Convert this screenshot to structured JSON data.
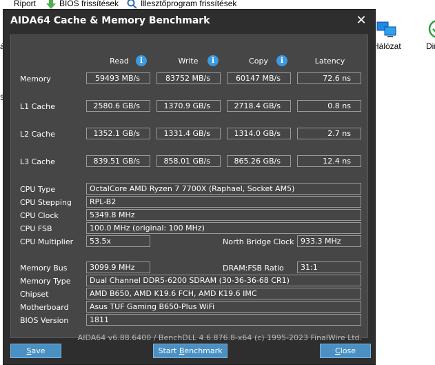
{
  "background": {
    "toolbar": [
      {
        "label": "Riport"
      },
      {
        "label": "BIOS frissítések"
      },
      {
        "label": "Illesztőprogram frissítések"
      }
    ],
    "side_labels": [
      "á",
      "S"
    ],
    "right_items": [
      {
        "label": "Hálózat"
      },
      {
        "label": "Dir"
      }
    ]
  },
  "window": {
    "title": "AIDA64 Cache & Memory Benchmark",
    "close_glyph": "✕"
  },
  "columns": {
    "read": "Read",
    "write": "Write",
    "copy": "Copy",
    "latency": "Latency"
  },
  "bench_rows": [
    {
      "label": "Memory",
      "read": "59493 MB/s",
      "write": "83752 MB/s",
      "copy": "60147 MB/s",
      "latency": "72.6 ns"
    },
    {
      "label": "L1 Cache",
      "read": "2580.6 GB/s",
      "write": "1370.9 GB/s",
      "copy": "2718.4 GB/s",
      "latency": "0.8 ns"
    },
    {
      "label": "L2 Cache",
      "read": "1352.1 GB/s",
      "write": "1331.4 GB/s",
      "copy": "1314.0 GB/s",
      "latency": "2.7 ns"
    },
    {
      "label": "L3 Cache",
      "read": "839.51 GB/s",
      "write": "858.01 GB/s",
      "copy": "865.26 GB/s",
      "latency": "12.4 ns"
    }
  ],
  "cpu": {
    "type_label": "CPU Type",
    "type_value": "OctalCore AMD Ryzen 7 7700X  (Raphael, Socket AM5)",
    "stepping_label": "CPU Stepping",
    "stepping_value": "RPL-B2",
    "clock_label": "CPU Clock",
    "clock_value": "5349.8 MHz",
    "fsb_label": "CPU FSB",
    "fsb_value": "100.0 MHz  (original: 100 MHz)",
    "multiplier_label": "CPU Multiplier",
    "multiplier_value": "53.5x",
    "nb_clock_label": "North Bridge Clock",
    "nb_clock_value": "933.3 MHz"
  },
  "system": {
    "membus_label": "Memory Bus",
    "membus_value": "3099.9 MHz",
    "ratio_label": "DRAM:FSB Ratio",
    "ratio_value": "31:1",
    "memtype_label": "Memory Type",
    "memtype_value": "Dual Channel DDR5-6200 SDRAM  (30-36-36-68 CR1)",
    "chipset_label": "Chipset",
    "chipset_value": "AMD B650, AMD K19.6 FCH, AMD K19.6 IMC",
    "motherboard_label": "Motherboard",
    "motherboard_value": "Asus TUF Gaming B650-Plus WiFi",
    "bios_label": "BIOS Version",
    "bios_value": "1811"
  },
  "footer_text": "AIDA64 v6.88.6400 / BenchDLL 4.6.876.8-x64  (c) 1995-2023 FinalWire Ltd.",
  "buttons": {
    "save": {
      "first": "S",
      "rest": "ave"
    },
    "start": {
      "pre": "Start ",
      "first": "B",
      "rest": "enchmark"
    },
    "close": {
      "first": "C",
      "rest": "lose"
    }
  },
  "colors": {
    "window_bg": "#2e2e2e",
    "panel_bg": "#464646",
    "accent": "#4a90c2",
    "info": "#3b9be0"
  }
}
